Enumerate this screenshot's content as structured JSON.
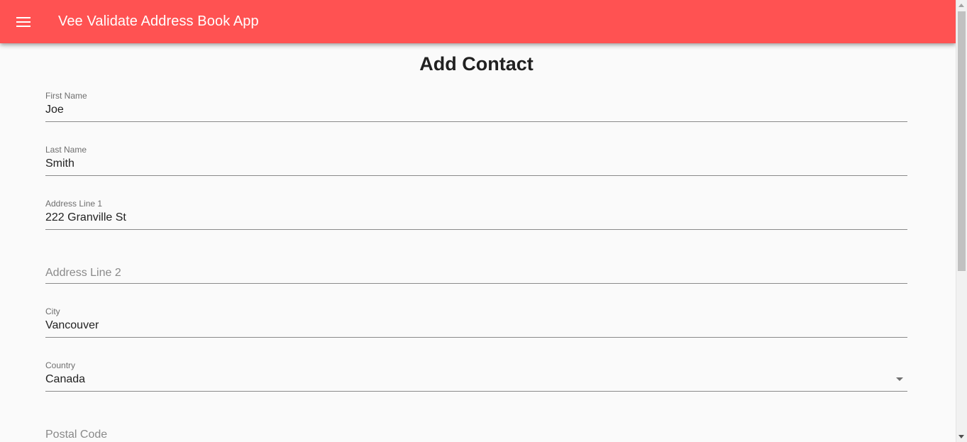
{
  "app_bar": {
    "title": "Vee Validate Address Book App",
    "menu_icon": "menu-icon",
    "color": "#ff5252"
  },
  "page": {
    "title": "Add Contact"
  },
  "form": {
    "first_name": {
      "label": "First Name",
      "value": "Joe"
    },
    "last_name": {
      "label": "Last Name",
      "value": "Smith"
    },
    "address_line_1": {
      "label": "Address Line 1",
      "value": "222 Granville St"
    },
    "address_line_2": {
      "placeholder": "Address Line 2",
      "value": ""
    },
    "city": {
      "label": "City",
      "value": "Vancouver"
    },
    "country": {
      "label": "Country",
      "value": "Canada",
      "icon": "dropdown-arrow-icon"
    },
    "postal_code": {
      "placeholder": "Postal Code",
      "value": ""
    }
  }
}
